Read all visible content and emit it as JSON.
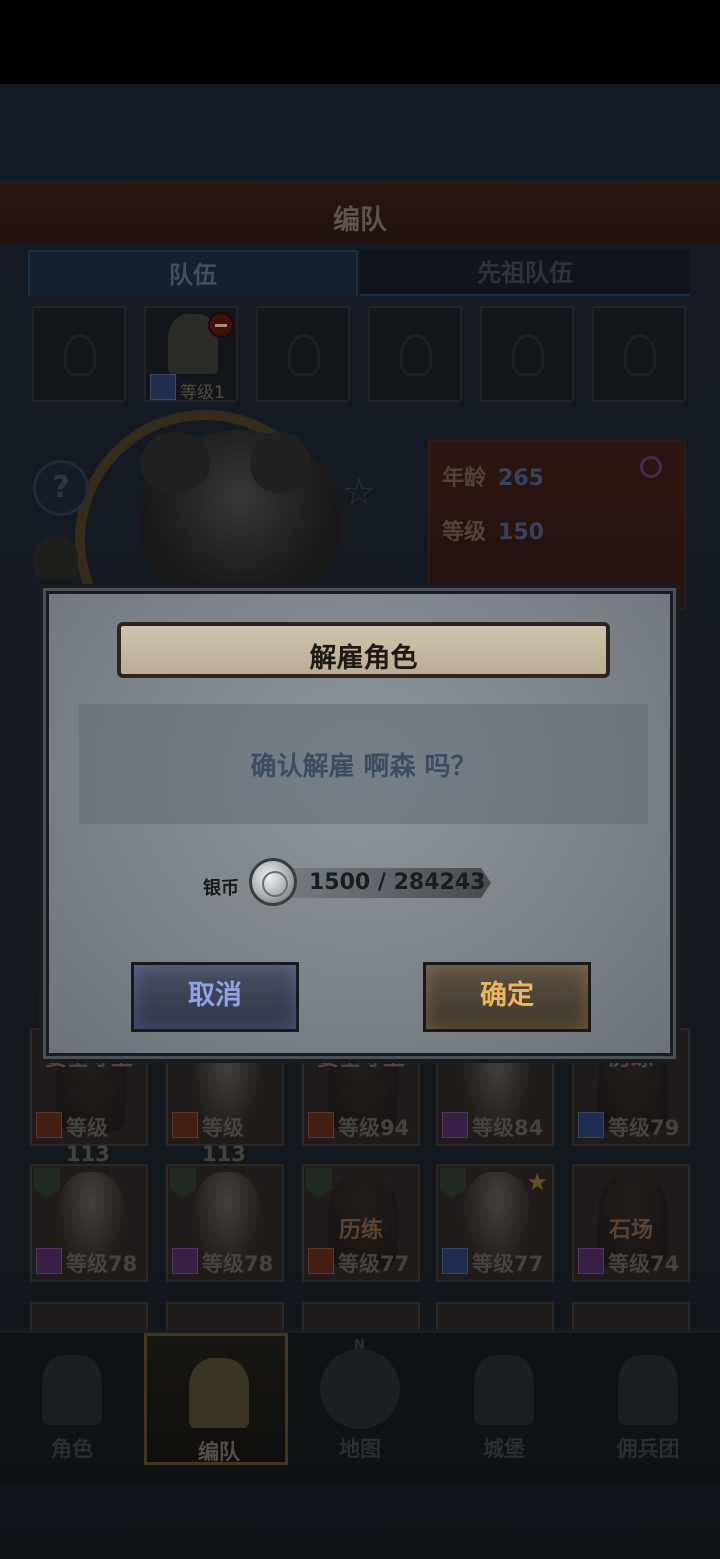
{
  "header": {
    "title": "编队"
  },
  "tabs": [
    {
      "label": "队伍",
      "active": true
    },
    {
      "label": "先祖队伍",
      "active": false
    }
  ],
  "team_slots": {
    "occupied_level": "等级1"
  },
  "character_stats": {
    "age_label": "年龄",
    "age_value": "265",
    "level_label": "等级",
    "level_value": "150"
  },
  "hero_grid": {
    "row1": [
      {
        "tag": "要塞守卫",
        "level": "等级113"
      },
      {
        "tag": "",
        "level": "等级113"
      },
      {
        "tag": "要塞守卫",
        "level": "等级94"
      },
      {
        "tag": "",
        "level": "等级84"
      },
      {
        "tag": "历练",
        "level": "等级79"
      }
    ],
    "row2": [
      {
        "tag": "",
        "level": "等级78"
      },
      {
        "tag": "",
        "level": "等级78"
      },
      {
        "tag": "历练",
        "level": "等级77"
      },
      {
        "tag": "",
        "level": "等级77"
      },
      {
        "tag": "石场",
        "level": "等级74"
      }
    ]
  },
  "bottom_nav": [
    {
      "label": "角色",
      "active": false
    },
    {
      "label": "编队",
      "active": true
    },
    {
      "label": "地图",
      "active": false
    },
    {
      "label": "城堡",
      "active": false
    },
    {
      "label": "佣兵团",
      "active": false
    }
  ],
  "compass_letter": "N",
  "dialog": {
    "title": "解雇角色",
    "message": "确认解雇 啊森 吗？",
    "cost_label": "银币",
    "cost_value": "1500 / 284243",
    "cancel_label": "取消",
    "confirm_label": "确定"
  }
}
